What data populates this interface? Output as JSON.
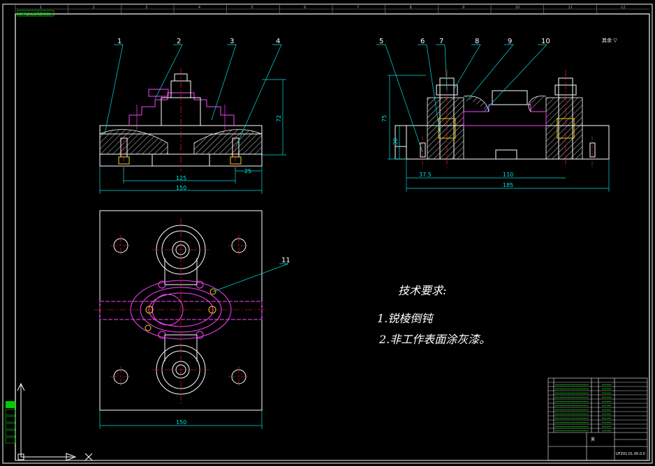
{
  "drawing": {
    "stamp": "0FRZ.SCTZ(00)",
    "top_ruler": [
      "1",
      "2",
      "3",
      "4",
      "5",
      "6",
      "7",
      "8",
      "9",
      "10",
      "11",
      "12"
    ],
    "roughness_note": "其余 ▽",
    "part_callouts": [
      "1",
      "2",
      "3",
      "4",
      "5",
      "6",
      "7",
      "8",
      "9",
      "10",
      "11"
    ],
    "front_view": {
      "dimensions": {
        "height": "72",
        "inner": "125",
        "overall": "150",
        "slot": "25"
      }
    },
    "side_view": {
      "dimensions": {
        "height_total": "75",
        "height_base": "30",
        "offset": "37.5",
        "center": "110",
        "overall": "185"
      }
    },
    "top_view": {
      "dimensions": {
        "overall": "150"
      }
    },
    "technical_requirements": {
      "title": "技术要求:",
      "items": [
        "1.锐棱倒钝",
        "2.非工作表面涂灰漆。"
      ]
    },
    "title_block": {
      "name": "夹",
      "drawing_no": "UFZ01.01.00.0.0"
    }
  },
  "colors": {
    "background": "#000000",
    "outline": "#ffffff",
    "center_line": "#ff2020",
    "dimension": "#00e0e0",
    "hidden": "#ff40ff",
    "hatch": "#ffffff",
    "yellow": "#ffd000"
  }
}
